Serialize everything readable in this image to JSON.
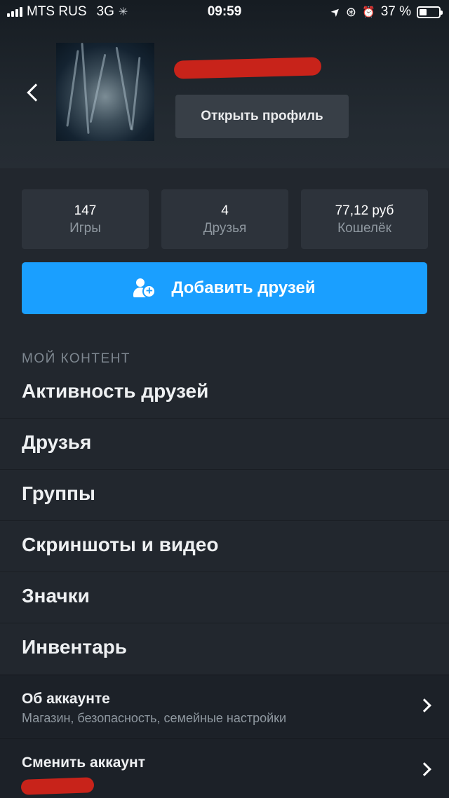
{
  "status_bar": {
    "carrier": "MTS RUS",
    "network": "3G",
    "loading_glyph": "✳",
    "time": "09:59",
    "location_glyph": "➤",
    "lock_glyph": "⊛",
    "alarm_glyph": "⏰",
    "battery_percent": "37 %",
    "battery_level": 0.37
  },
  "profile": {
    "open_profile_label": "Открыть профиль"
  },
  "stats": [
    {
      "value": "147",
      "label": "Игры"
    },
    {
      "value": "4",
      "label": "Друзья"
    },
    {
      "value": "77,12 руб",
      "label": "Кошелёк"
    }
  ],
  "add_friends_label": "Добавить друзей",
  "content": {
    "section_title": "МОЙ КОНТЕНТ",
    "items": [
      {
        "label": "Активность друзей"
      },
      {
        "label": "Друзья"
      },
      {
        "label": "Группы"
      },
      {
        "label": "Скриншоты и видео"
      },
      {
        "label": "Значки"
      },
      {
        "label": "Инвентарь"
      }
    ],
    "account": {
      "title": "Об аккаунте",
      "description": "Магазин, безопасность, семейные настройки"
    },
    "switch_account": {
      "title": "Сменить аккаунт"
    }
  },
  "colors": {
    "accent": "#1a9fff",
    "redaction": "#c8231a",
    "background": "#22272e"
  }
}
